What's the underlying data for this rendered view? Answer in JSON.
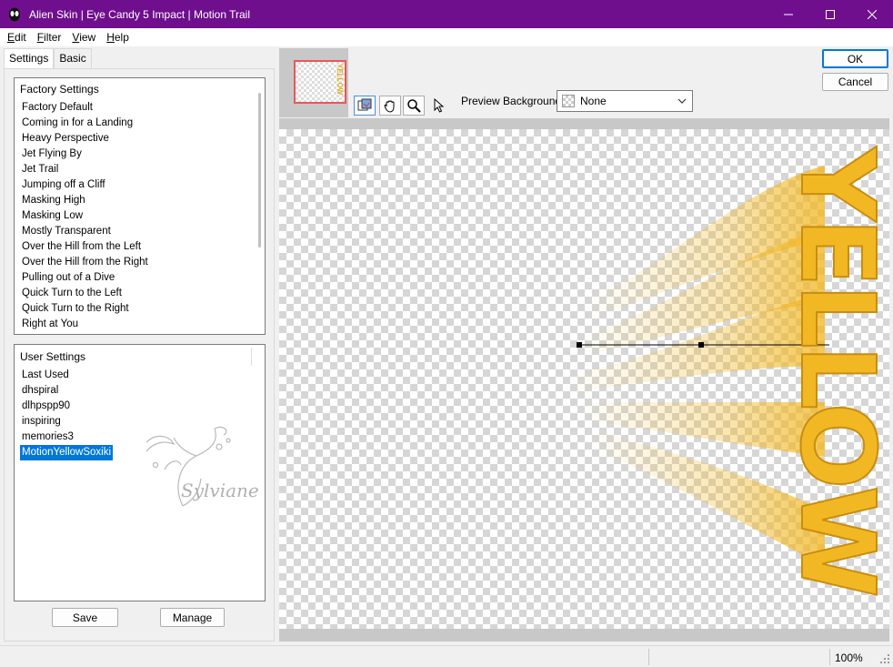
{
  "window": {
    "title": "Alien Skin | Eye Candy 5 Impact | Motion Trail",
    "minimize_icon": "minimize-icon",
    "maximize_icon": "maximize-icon",
    "close_icon": "close-icon"
  },
  "menu": [
    {
      "label_u": "E",
      "label_rest": "dit"
    },
    {
      "label_u": "F",
      "label_rest": "ilter"
    },
    {
      "label_u": "V",
      "label_rest": "iew"
    },
    {
      "label_u": "H",
      "label_rest": "elp"
    }
  ],
  "tabs": {
    "settings": "Settings",
    "basic": "Basic"
  },
  "factory_settings": {
    "header": "Factory Settings",
    "items": [
      "Factory Default",
      "Coming in for a Landing",
      "Heavy Perspective",
      "Jet Flying By",
      "Jet Trail",
      "Jumping off a Cliff",
      "Masking High",
      "Masking Low",
      "Mostly Transparent",
      "Over the Hill from the Left",
      "Over the Hill from the Right",
      "Pulling out of a Dive",
      "Quick Turn to the Left",
      "Quick Turn to the Right",
      "Right at You"
    ]
  },
  "user_settings": {
    "header": "User Settings",
    "items": [
      "Last Used",
      "dhspiral",
      "dlhpspp90",
      "inspiring",
      "memories3",
      "MotionYellowSoxiki"
    ],
    "selected_index": 5
  },
  "watermark_text": "Sylviane",
  "buttons": {
    "save": "Save",
    "manage": "Manage",
    "ok": "OK",
    "cancel": "Cancel"
  },
  "preview": {
    "thumb_text": "YELLOW",
    "background_label": "Preview Background:",
    "background_value": "None",
    "canvas_text": "YELLOW",
    "text_color": "#f2b824",
    "tools": [
      "preview-toggle-icon",
      "hand-pan-icon",
      "zoom-icon",
      "pointer-icon"
    ]
  },
  "status": {
    "zoom": "100%"
  },
  "colors": {
    "titlebar": "#6f0f8e",
    "selection": "#0078d7"
  }
}
